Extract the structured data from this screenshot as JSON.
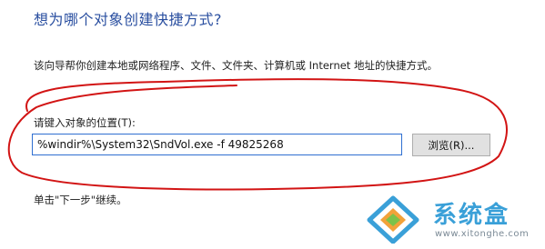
{
  "dialog": {
    "title": "想为哪个对象创建快捷方式?",
    "description": "该向导帮你创建本地或网络程序、文件、文件夹、计算机或 Internet 地址的快捷方式。",
    "location_label": "请键入对象的位置(T):",
    "location_value": "%windir%\\System32\\SndVol.exe -f 49825268",
    "browse_label": "浏览(R)...",
    "footer": "单击\"下一步\"继续。"
  },
  "watermark": {
    "brand": "系统盒",
    "url": "www.xitonghe.com"
  },
  "colors": {
    "title": "#2a4fa0",
    "annotation": "#d21414",
    "input_border": "#2f6fd1",
    "watermark_brand": "#3aa0d8"
  }
}
